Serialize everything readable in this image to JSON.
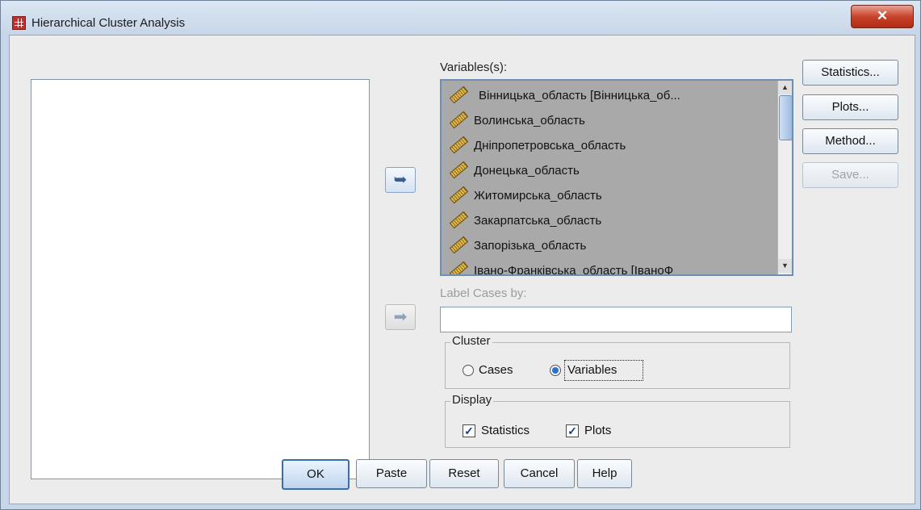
{
  "window": {
    "title": "Hierarchical Cluster Analysis",
    "close_glyph": "✕"
  },
  "variables": {
    "label": "Variables(s):",
    "items": [
      "Вінницька_область [Вінницька_об...",
      "Волинська_область",
      "Дніпропетровська_область",
      "Донецька_область",
      "Житомирська_область",
      "Закарпатська_область",
      "Запорізька_область",
      "Івано-Франківська_область [ІваноФ"
    ],
    "scroll_up": "▲",
    "scroll_down": "▼"
  },
  "label_cases": {
    "label": "Label Cases by:",
    "value": ""
  },
  "arrows": {
    "move_back": "➥",
    "move_in": "➡"
  },
  "cluster": {
    "title": "Cluster",
    "options": [
      {
        "label": "Cases",
        "selected": false
      },
      {
        "label": "Variables",
        "selected": true
      }
    ]
  },
  "display": {
    "title": "Display",
    "options": [
      {
        "label": "Statistics",
        "checked": true
      },
      {
        "label": "Plots",
        "checked": true
      }
    ]
  },
  "side_buttons": {
    "statistics": "Statistics...",
    "plots": "Plots...",
    "method": "Method...",
    "save": "Save..."
  },
  "bottom_buttons": {
    "ok": "OK",
    "paste": "Paste",
    "reset": "Reset",
    "cancel": "Cancel",
    "help": "Help"
  },
  "icons": {
    "variable": "scale-ruler-icon",
    "app": "spss-table-icon"
  },
  "colors": {
    "list_selection": "#a9a9a9",
    "focus_border": "#6d8fb4",
    "close_button": "#c8432c"
  }
}
